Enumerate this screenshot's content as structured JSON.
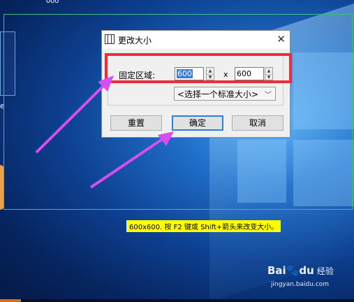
{
  "dialog": {
    "title": "更改大小",
    "label_fixed_area": "固定区域:",
    "width_value": "600",
    "height_value": "600",
    "separator": "x",
    "preset_select": "<选择一个标准大小>",
    "buttons": {
      "reset": "重置",
      "ok": "确定",
      "cancel": "取消"
    }
  },
  "hint": "600x600.  按 F2 键或 Shift+箭头来改变大小。",
  "watermark": {
    "brand": "Bai",
    "brand2": "du",
    "sub": "经验",
    "url": "jingyan.baidu.com"
  },
  "left_char": "e",
  "top_char": "ooo",
  "icons": {
    "dialog": "film-icon",
    "close": "close-icon"
  },
  "colors": {
    "highlight": "#f22b3a",
    "arrow": "#d94cf0",
    "hint_bg": "#ffff00"
  }
}
